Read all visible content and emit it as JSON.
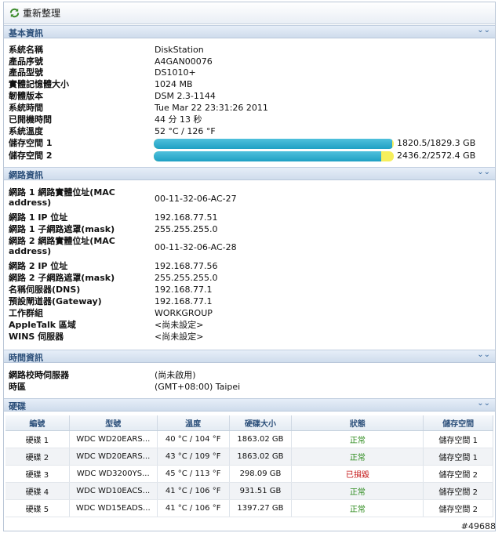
{
  "toolbar": {
    "refresh_label": "重新整理"
  },
  "sections": {
    "basic": "基本資訊",
    "network": "網路資訊",
    "time": "時間資訊",
    "disk": "硬碟"
  },
  "basic": [
    {
      "k": "系統名稱",
      "v": "DiskStation"
    },
    {
      "k": "產品序號",
      "v": "A4GAN00076"
    },
    {
      "k": "產品型號",
      "v": "DS1010+"
    },
    {
      "k": "實體記憶體大小",
      "v": "1024 MB"
    },
    {
      "k": "韌體版本",
      "v": "DSM 2.3-1144"
    },
    {
      "k": "系統時間",
      "v": "Tue Mar 22 23:31:26 2011"
    },
    {
      "k": "已開機時間",
      "v": "44 分 13 秒"
    },
    {
      "k": "系統溫度",
      "v": "52 °C / 126 °F"
    }
  ],
  "storage": [
    {
      "k": "儲存空間 1",
      "v": "1820.5/1829.3 GB",
      "used_fraction": 0.995
    },
    {
      "k": "儲存空間 2",
      "v": "2436.2/2572.4 GB",
      "used_fraction": 0.947
    }
  ],
  "network": [
    {
      "k": "網路 1 網路實體位址(MAC address)",
      "v": "00-11-32-06-AC-27"
    },
    {
      "k": "網路 1 IP 位址",
      "v": "192.168.77.51"
    },
    {
      "k": "網路 1 子網路遮罩(mask)",
      "v": "255.255.255.0"
    },
    {
      "k": "網路 2 網路實體位址(MAC address)",
      "v": "00-11-32-06-AC-28"
    },
    {
      "k": "網路 2 IP 位址",
      "v": "192.168.77.56"
    },
    {
      "k": "網路 2 子網路遮罩(mask)",
      "v": "255.255.255.0"
    },
    {
      "k": "名稱伺服器(DNS)",
      "v": "192.168.77.1"
    },
    {
      "k": "預設閘道器(Gateway)",
      "v": "192.168.77.1"
    },
    {
      "k": "工作群組",
      "v": "WORKGROUP"
    },
    {
      "k": "AppleTalk 區域",
      "v": "<尚未設定>"
    },
    {
      "k": "WINS 伺服器",
      "v": "<尚未設定>"
    }
  ],
  "time": [
    {
      "k": "網路校時伺服器",
      "v": "(尚未啟用)"
    },
    {
      "k": "時區",
      "v": "(GMT+08:00) Taipei"
    }
  ],
  "disk_headers": [
    "編號",
    "型號",
    "溫度",
    "硬碟大小",
    "狀態",
    "儲存空間"
  ],
  "disks": [
    [
      "硬碟 1",
      "WDC WD20EARS...",
      "40 °C / 104 °F",
      "1863.02 GB",
      "正常",
      "儲存空間 1"
    ],
    [
      "硬碟 2",
      "WDC WD20EARS...",
      "43 °C / 109 °F",
      "1863.02 GB",
      "正常",
      "儲存空間 1"
    ],
    [
      "硬碟 3",
      "WDC WD3200YS...",
      "45 °C / 113 °F",
      "298.09 GB",
      "已損毀",
      "儲存空間 2"
    ],
    [
      "硬碟 4",
      "WDC WD10EACS...",
      "41 °C / 106 °F",
      "931.51 GB",
      "正常",
      "儲存空間 2"
    ],
    [
      "硬碟 5",
      "WDC WD15EADS...",
      "41 °C / 106 °F",
      "1397.27 GB",
      "正常",
      "儲存空間 2"
    ]
  ],
  "status_colors": {
    "正常": "#2b8a1b",
    "已損毀": "#c41616"
  },
  "watermark": "#49688"
}
